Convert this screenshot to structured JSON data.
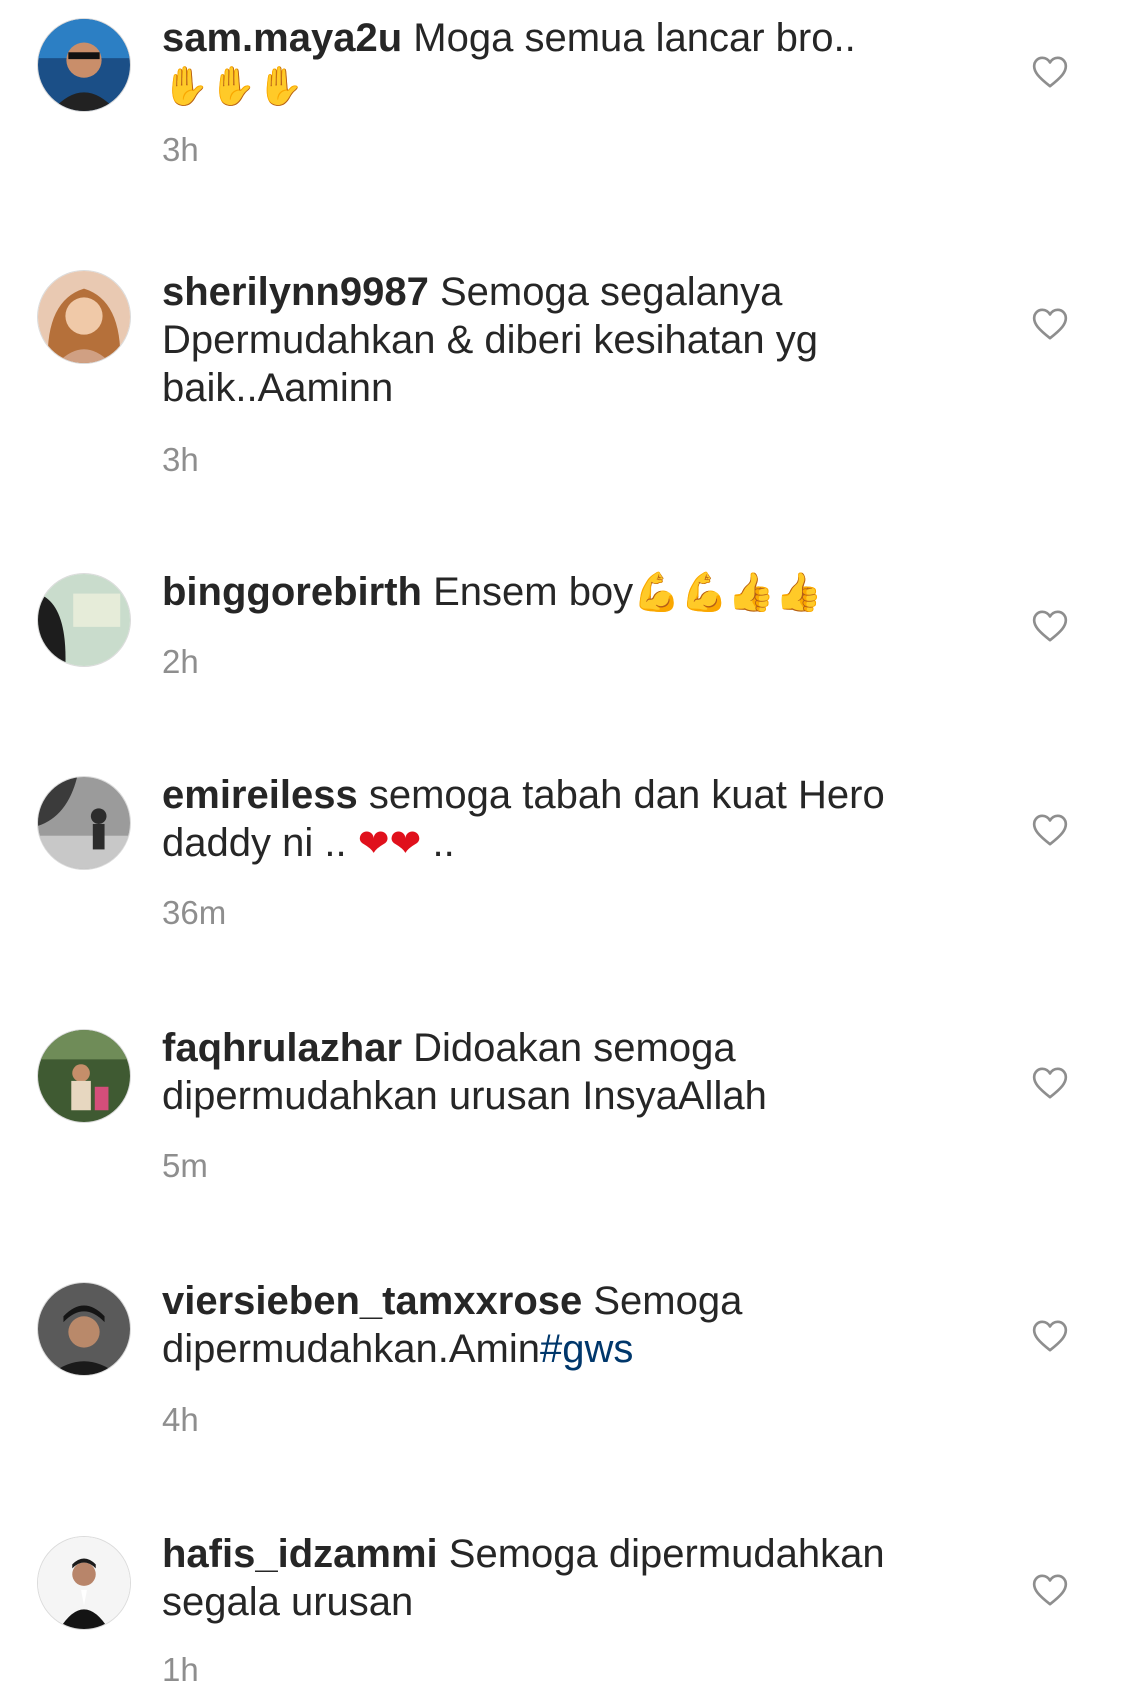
{
  "comments": [
    {
      "username": "sam.maya2u",
      "text": " Moga semua lancar bro..",
      "emoji": "✋✋✋",
      "time": "3h",
      "avatar_icon": "profile-photo",
      "avatar_color": "#3a6fa8"
    },
    {
      "username": "sherilynn9987",
      "text": " Semoga segalanya Dpermudahkan & diberi kesihatan yg baik..Aaminn",
      "time": "3h",
      "avatar_icon": "profile-photo",
      "avatar_color": "#d9a07e"
    },
    {
      "username": "binggorebirth",
      "text": " Ensem boy",
      "emoji": "💪💪👍👍",
      "time": "2h",
      "avatar_icon": "profile-photo",
      "avatar_color": "#8fbf9a"
    },
    {
      "username": "emireiless",
      "text": " semoga tabah dan kuat Hero daddy ni .. ",
      "emoji": "❤❤",
      "text_after": " ..",
      "time": "36m",
      "avatar_icon": "profile-photo",
      "avatar_color": "#7a7a7a"
    },
    {
      "username": "faqhrulazhar",
      "text": " Didoakan semoga dipermudahkan urusan InsyaAllah",
      "time": "5m",
      "avatar_icon": "profile-photo",
      "avatar_color": "#4c6a3c"
    },
    {
      "username": "viersieben_tamxxrose",
      "text": " Semoga dipermudahkan.Amin",
      "hashtag": "#gws",
      "time": "4h",
      "avatar_icon": "profile-photo",
      "avatar_color": "#3d3d3d"
    },
    {
      "username": "hafis_idzammi",
      "text": " Semoga dipermudahkan segala urusan",
      "time": "1h",
      "avatar_icon": "profile-photo",
      "avatar_color": "#e8e8e8"
    }
  ],
  "like_icon": "heart-outline-icon",
  "colors": {
    "text": "#262626",
    "muted": "#8e8e8e",
    "hashtag": "#00376b"
  }
}
